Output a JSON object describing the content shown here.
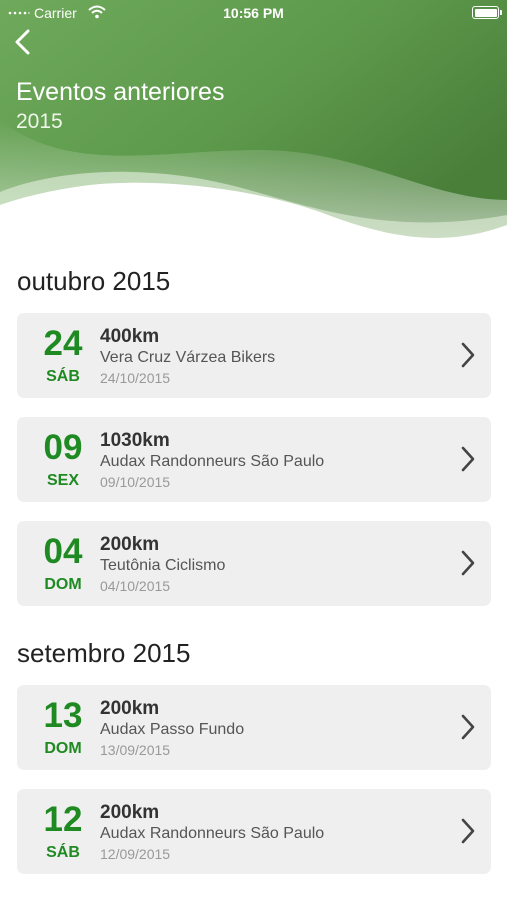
{
  "status_bar": {
    "carrier": "Carrier",
    "time": "10:56 PM"
  },
  "header": {
    "title": "Eventos anteriores",
    "subtitle": "2015"
  },
  "colors": {
    "accent_green": "#1f8a22",
    "header_green": "#4f8a3f",
    "card_bg": "#efefef"
  },
  "sections": [
    {
      "title": "outubro 2015",
      "events": [
        {
          "day": "24",
          "weekday": "SÁB",
          "distance": "400km",
          "organizer": "Vera Cruz Várzea Bikers",
          "date": "24/10/2015"
        },
        {
          "day": "09",
          "weekday": "SEX",
          "distance": "1030km",
          "organizer": "Audax Randonneurs São Paulo",
          "date": "09/10/2015"
        },
        {
          "day": "04",
          "weekday": "DOM",
          "distance": "200km",
          "organizer": "Teutônia Ciclismo",
          "date": "04/10/2015"
        }
      ]
    },
    {
      "title": "setembro 2015",
      "events": [
        {
          "day": "13",
          "weekday": "DOM",
          "distance": "200km",
          "organizer": "Audax Passo Fundo",
          "date": "13/09/2015"
        },
        {
          "day": "12",
          "weekday": "SÁB",
          "distance": "200km",
          "organizer": "Audax Randonneurs São Paulo",
          "date": "12/09/2015"
        }
      ]
    }
  ]
}
